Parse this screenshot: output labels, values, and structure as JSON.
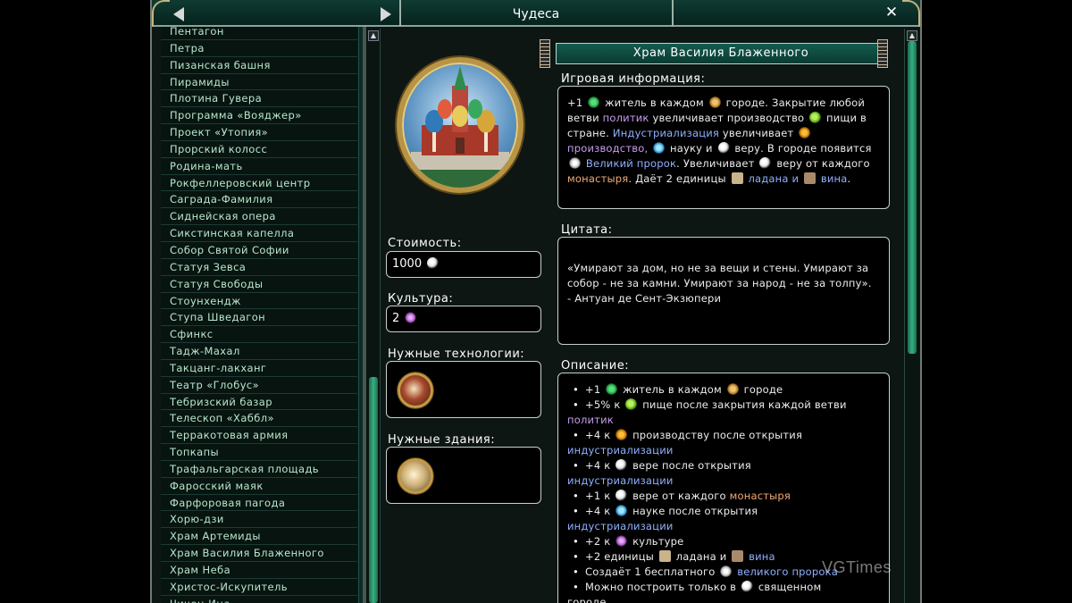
{
  "window": {
    "title": "Чудеса"
  },
  "wonder_list": [
    "Пентагон",
    "Петра",
    "Пизанская башня",
    "Пирамиды",
    "Плотина Гувера",
    "Программа «Вояджер»",
    "Проект «Утопия»",
    "Прорский колосс",
    "Родина-мать",
    "Рокфеллеровский центр",
    "Саграда-Фамилия",
    "Сиднейская опера",
    "Сикстинская капелла",
    "Собор Святой Софии",
    "Статуя Зевса",
    "Статуя Свободы",
    "Стоунхендж",
    "Ступа Шведагон",
    "Сфинкс",
    "Тадж-Махал",
    "Такцанг-лакханг",
    "Театр «Глобус»",
    "Тебризский базар",
    "Телескоп «Хаббл»",
    "Терракотовая армия",
    "Топкапы",
    "Трафальгарская площадь",
    "Фаросский маяк",
    "Фарфоровая пагода",
    "Хорю-дзи",
    "Храм Артемиды",
    "Храм Василия Блаженного",
    "Храм Неба",
    "Христос-Искупитель",
    "Чичен-Ица"
  ],
  "detail": {
    "name": "Храм Василия Блаженного",
    "cost_label": "Стоимость:",
    "cost_value": "1000",
    "culture_label": "Культура:",
    "culture_value": "2",
    "tech_label": "Нужные технологии:",
    "buildings_label": "Нужные здания:",
    "game_info_label": "Игровая информация:",
    "quote_label": "Цитата:",
    "description_label": "Описание:",
    "quote_text": "«Умирают за дом, но не за вещи и стены. Умирают за собор - не за камни. Умирают за народ - не за толпу».",
    "quote_author": "- Антуан де Сент-Экзюпери",
    "game_info": {
      "p1": "+1",
      "p2": "житель в каждом",
      "p3": "городе. Закрытие любой ветви",
      "p4": "политик",
      "p5": "увеличивает производство",
      "p6": "пищи в стране.",
      "p7": "Индустриализация",
      "p8": "увеличивает",
      "p9": "производство,",
      "p10": "науку и",
      "p11": "веру. В городе появится",
      "p12": "Великий пророк",
      "p13": ". Увеличивает",
      "p14": "веру от каждого",
      "p15": "монастыря",
      "p16": ". Даёт 2 единицы",
      "p17": "ладана и",
      "p18": "вина",
      "p19": "."
    },
    "description": {
      "d1a": "+1",
      "d1b": "житель в каждом",
      "d1c": "городе",
      "d2a": "+5% к",
      "d2b": "пище после закрытия каждой ветви",
      "d2c": "политик",
      "d3a": "+4 к",
      "d3b": "производству после открытия",
      "d3c": "индустриализации",
      "d4a": "+4 к",
      "d4b": "вере после открытия",
      "d4c": "индустриализации",
      "d5a": "+1 к",
      "d5b": "вере от каждого",
      "d5c": "монастыря",
      "d6a": "+4 к",
      "d6b": "науке после открытия",
      "d6c": "индустриализации",
      "d7a": "+2 к",
      "d7b": "культуре",
      "d8a": "+2 единицы",
      "d8b": "ладана и",
      "d8c": "вина",
      "d9a": "Создаёт 1 бесплатного",
      "d9b": "великого пророка",
      "d10a": "Можно построить только в",
      "d10b": "священном",
      "d10c": "городе"
    }
  },
  "watermark": "VGTimes",
  "icons": {
    "faith": "faith-dove-icon",
    "culture": "culture-icon",
    "citizen": "citizen-icon",
    "city": "city-icon",
    "food": "food-icon",
    "production": "production-icon",
    "science": "science-icon",
    "great_prophet": "great-prophet-icon",
    "incense": "incense-icon",
    "wine": "wine-icon"
  }
}
